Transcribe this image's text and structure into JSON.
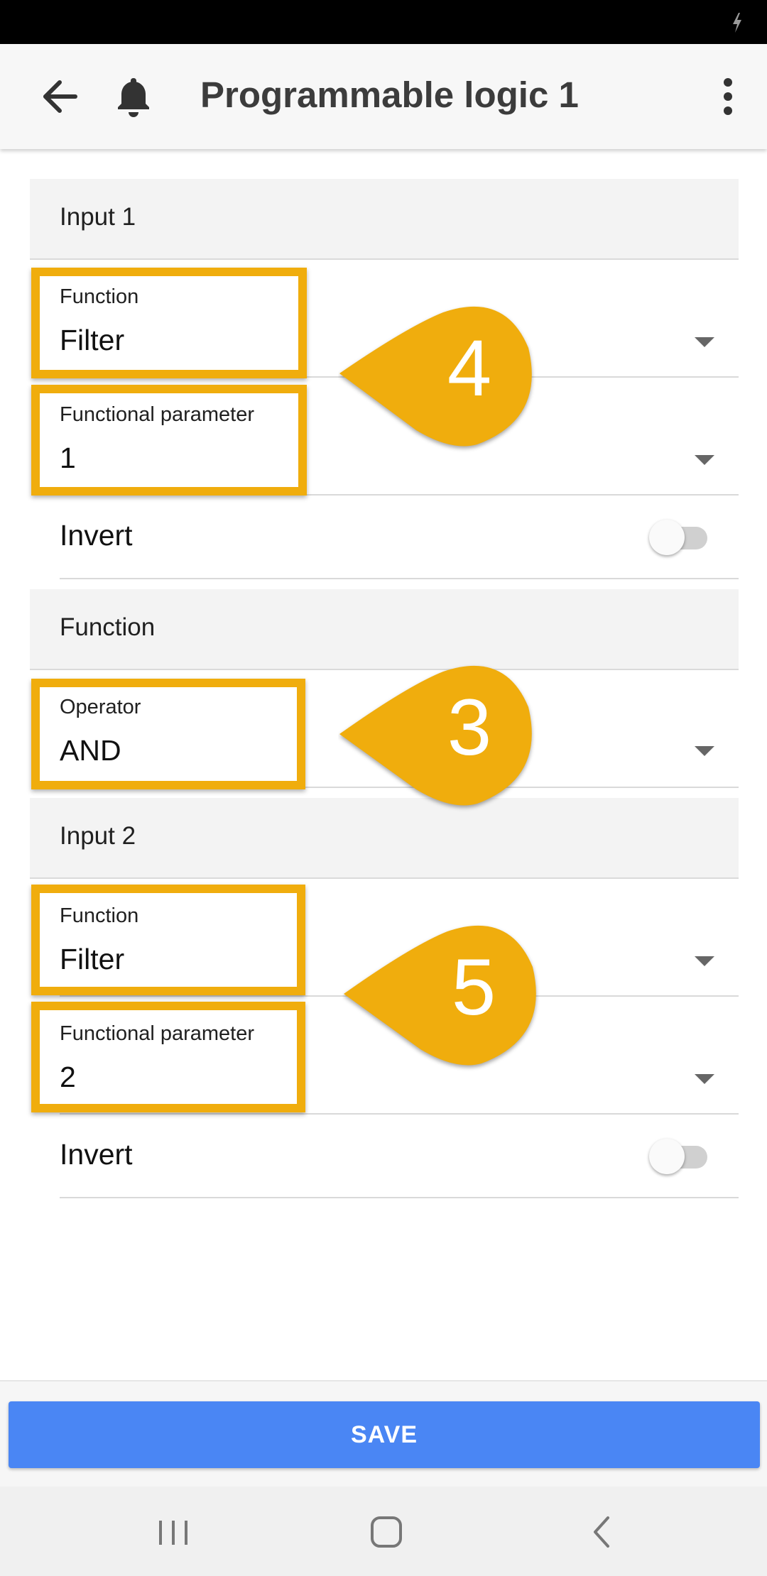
{
  "app_bar": {
    "title": "Programmable logic 1"
  },
  "input1": {
    "header": "Input 1",
    "function_label": "Function",
    "function_value": "Filter",
    "parameter_label": "Functional parameter",
    "parameter_value": "1",
    "invert_label": "Invert",
    "invert_on": false
  },
  "function_section": {
    "header": "Function",
    "operator_label": "Operator",
    "operator_value": "AND"
  },
  "input2": {
    "header": "Input 2",
    "function_label": "Function",
    "function_value": "Filter",
    "parameter_label": "Functional parameter",
    "parameter_value": "2",
    "invert_label": "Invert",
    "invert_on": false
  },
  "callouts": {
    "input1": "4",
    "operator": "3",
    "input2": "5"
  },
  "save_label": "SAVE",
  "colors": {
    "accent": "#4a86f4",
    "highlight": "#f0ad0d"
  }
}
